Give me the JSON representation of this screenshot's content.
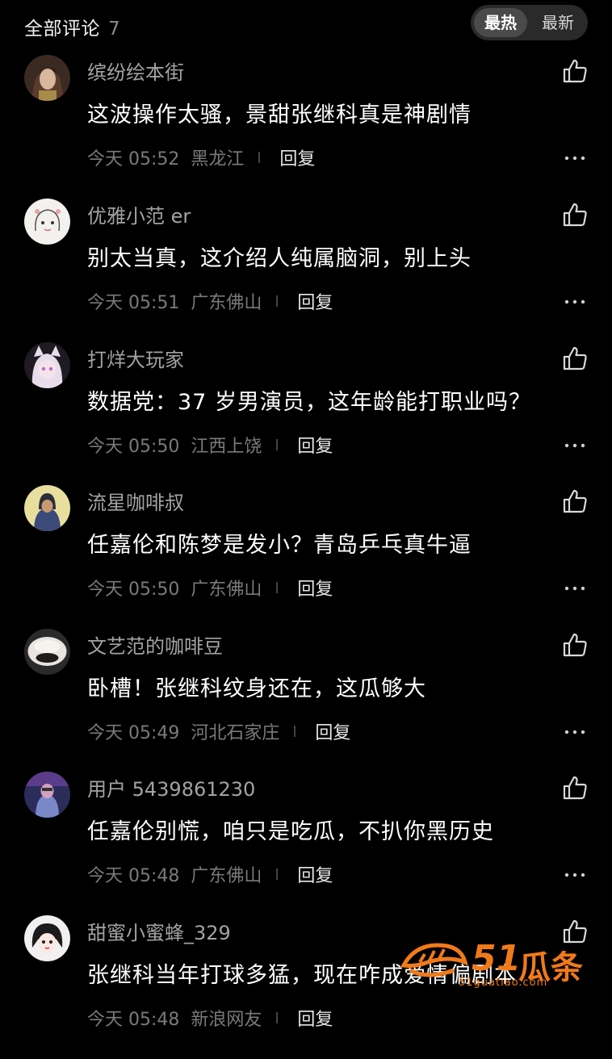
{
  "header": {
    "title": "全部评论",
    "count": "7",
    "sort_hot": "最热",
    "sort_new": "最新"
  },
  "comments": [
    {
      "username": "缤纷绘本街",
      "text": "这波操作太骚，景甜张继科真是神剧情",
      "time": "今天 05:52",
      "location": "黑龙江",
      "reply": "回复",
      "avatar_icon": "avatar-anime-warrior"
    },
    {
      "username": "优雅小范 er",
      "text": "别太当真，这介绍人纯属脑洞，别上头",
      "time": "今天 05:51",
      "location": "广东佛山",
      "reply": "回复",
      "avatar_icon": "avatar-sketch-girl"
    },
    {
      "username": "打烊大玩家",
      "text": "数据党：37 岁男演员，这年龄能打职业吗？",
      "time": "今天 05:50",
      "location": "江西上饶",
      "reply": "回复",
      "avatar_icon": "avatar-catgirl"
    },
    {
      "username": "流星咖啡叔",
      "text": "任嘉伦和陈梦是发小？青岛乒乓真牛逼",
      "time": "今天 05:50",
      "location": "广东佛山",
      "reply": "回复",
      "avatar_icon": "avatar-hoodie"
    },
    {
      "username": "文艺范的咖啡豆",
      "text": "卧槽！张继科纹身还在，这瓜够大",
      "time": "今天 05:49",
      "location": "河北石家庄",
      "reply": "回复",
      "avatar_icon": "avatar-plush"
    },
    {
      "username": "用户 5439861230",
      "text": "任嘉伦别慌，咱只是吃瓜，不扒你黑历史",
      "time": "今天 05:48",
      "location": "广东佛山",
      "reply": "回复",
      "avatar_icon": "avatar-neon-figure"
    },
    {
      "username": "甜蜜小蜜蜂_329",
      "text": "张继科当年打球多猛，现在咋成爱情偏剧本",
      "time": "今天 05:48",
      "location": "新浪网友",
      "reply": "回复",
      "avatar_icon": "avatar-cartoon-girl"
    }
  ],
  "watermark": {
    "num": "51",
    "text": "瓜条",
    "url": "51guatiao.com"
  },
  "colors": {
    "background": "#000000",
    "username": "#a3a3a3",
    "meta": "#7a7a7a",
    "watermark": "#f07a1a"
  }
}
